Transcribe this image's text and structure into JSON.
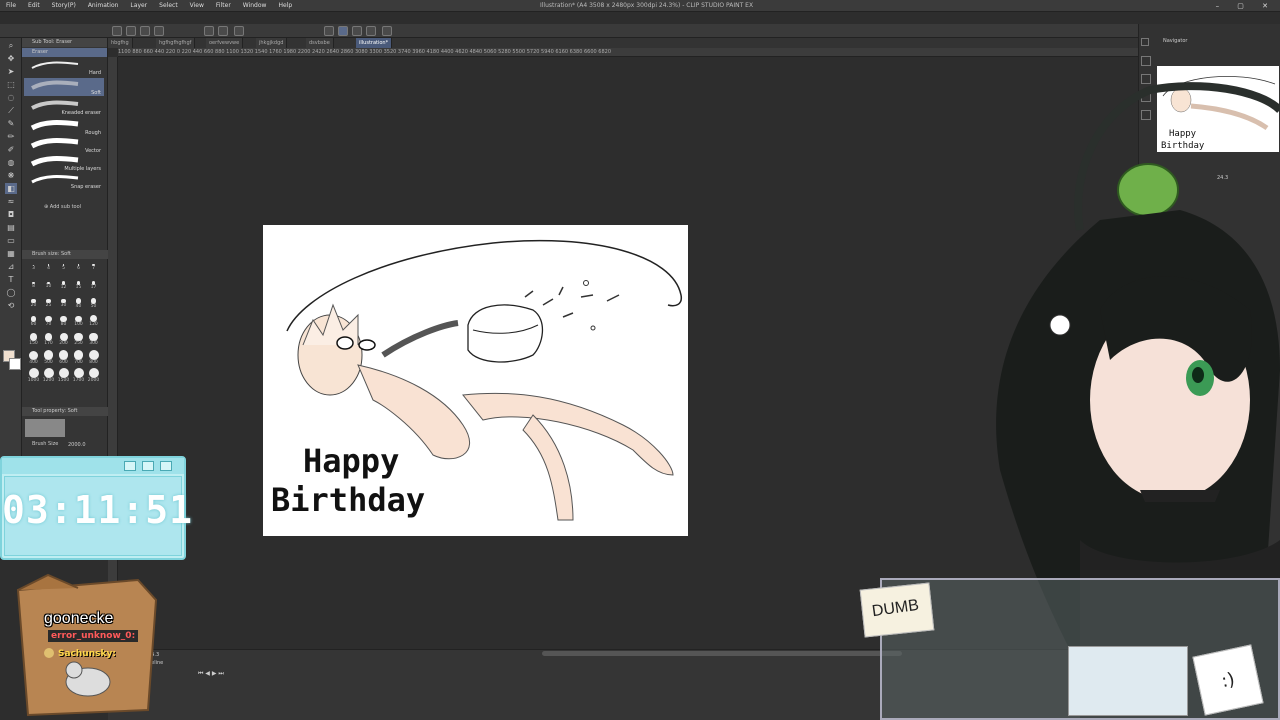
{
  "window": {
    "title": "Illustration* (A4 3508 x 2480px 300dpi 24.3%) - CLIP STUDIO PAINT EX"
  },
  "menu": [
    "File",
    "Edit",
    "Story(P)",
    "Animation",
    "Layer",
    "Select",
    "View",
    "Filter",
    "Window",
    "Help"
  ],
  "tabs": [
    "hbgfhg",
    "hgfhgfhgfhgf",
    "oerfvewvwe",
    "jhkgjkdgd",
    "dsvbsbe",
    "illustration*"
  ],
  "ruler_labels": "1100 880 660 440 220 0 220 440 660 880 1100 1320 1540 1760 1980 2200 2420 2640 2860 3080 3300 3520 3740 3960 4180 4400 4620 4840 5060 5280 5500 5720 5940 6160 6380 6600 6820",
  "subtool": {
    "panel_title": "Sub Tool: Eraser",
    "group": "Eraser",
    "items": [
      "Hard",
      "Soft",
      "Kneaded eraser",
      "Rough",
      "Vector",
      "Multiple layers",
      "Snap eraser"
    ],
    "add_label": "Add sub tool"
  },
  "brush_size_panel": {
    "title": "Brush size: Soft",
    "sizes": [
      "3",
      "4",
      "5",
      "6",
      "7",
      "8",
      "10",
      "12",
      "15",
      "17",
      "20",
      "25",
      "30",
      "40",
      "50",
      "60",
      "70",
      "80",
      "100",
      "120",
      "150",
      "170",
      "200",
      "250",
      "300",
      "400",
      "500",
      "600",
      "700",
      "800",
      "1000",
      "1200",
      "1500",
      "1700",
      "2000"
    ]
  },
  "tool_property": {
    "title": "Tool property: Soft",
    "brush_size_label": "Brush Size",
    "brush_size_value": "2000.0"
  },
  "navigator": {
    "title": "Navigator",
    "zoom": "24.3"
  },
  "canvas": {
    "line1": "Happy",
    "line2": "Birthday"
  },
  "timer": {
    "value": "03:11:51"
  },
  "chat": {
    "username": "goonecke",
    "msg1": "error_unknow_0:",
    "msg2": "Sachunsky:"
  },
  "timeline": {
    "title": "Timeline",
    "zoom": "24.3"
  },
  "sticker": {
    "text": "DUMB"
  },
  "colors": {
    "accent": "#5a6a8a",
    "timer_bg": "#bfeef2",
    "canvas": "#ffffff"
  }
}
